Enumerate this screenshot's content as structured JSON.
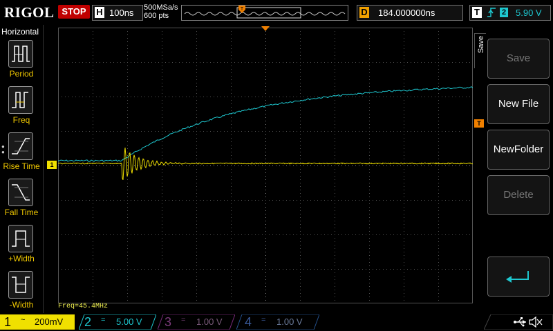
{
  "topbar": {
    "brand": "RIGOL",
    "run_state": "STOP",
    "timebase_letter": "H",
    "timebase_value": "100ns",
    "sample_rate": "500MSa/s",
    "memory_depth": "600 pts",
    "delay_letter": "D",
    "delay_value": "184.000000ns",
    "trigger_letter": "T",
    "trigger_source": "2",
    "trigger_level": "5.90 V"
  },
  "left_menu": {
    "title": "Horizontal",
    "items": [
      {
        "label": "Period",
        "icon": "period-icon"
      },
      {
        "label": "Freq",
        "icon": "freq-icon"
      },
      {
        "label": "Rise Time",
        "icon": "rise-time-icon"
      },
      {
        "label": "Fall Time",
        "icon": "fall-time-icon"
      },
      {
        "label": "+Width",
        "icon": "positive-width-icon"
      },
      {
        "label": "-Width",
        "icon": "negative-width-icon"
      }
    ]
  },
  "measurement": {
    "freq_readout": "Freq=45.4MHz"
  },
  "right_menu": {
    "tab_label": "Save",
    "buttons": [
      {
        "label": "Save",
        "enabled": false
      },
      {
        "label": "New File",
        "enabled": true
      },
      {
        "label": "NewFolder",
        "enabled": true
      },
      {
        "label": "Delete",
        "enabled": false
      },
      {
        "label": "",
        "icon": "return-arrow-icon",
        "enabled": true
      }
    ]
  },
  "channels": [
    {
      "num": "1",
      "coupling": "~",
      "scale": "200mV",
      "color": "#f0e000",
      "active": true
    },
    {
      "num": "2",
      "coupling": "=",
      "scale": "5.00 V",
      "color": "#1ec8d0",
      "active": true
    },
    {
      "num": "3",
      "coupling": "=",
      "scale": "1.00 V",
      "color": "#d040d0",
      "active": false
    },
    {
      "num": "4",
      "coupling": "=",
      "scale": "1.00 V",
      "color": "#3070d0",
      "active": false
    }
  ],
  "markers": {
    "ch1_level": "1",
    "trigger_level": "T"
  },
  "status_icons": [
    "usb-icon",
    "speaker-mute-icon"
  ],
  "colors": {
    "ch1": "#f0e000",
    "ch2": "#1ec8d0",
    "trigger_marker": "#f08000",
    "stop": "#c00000"
  }
}
